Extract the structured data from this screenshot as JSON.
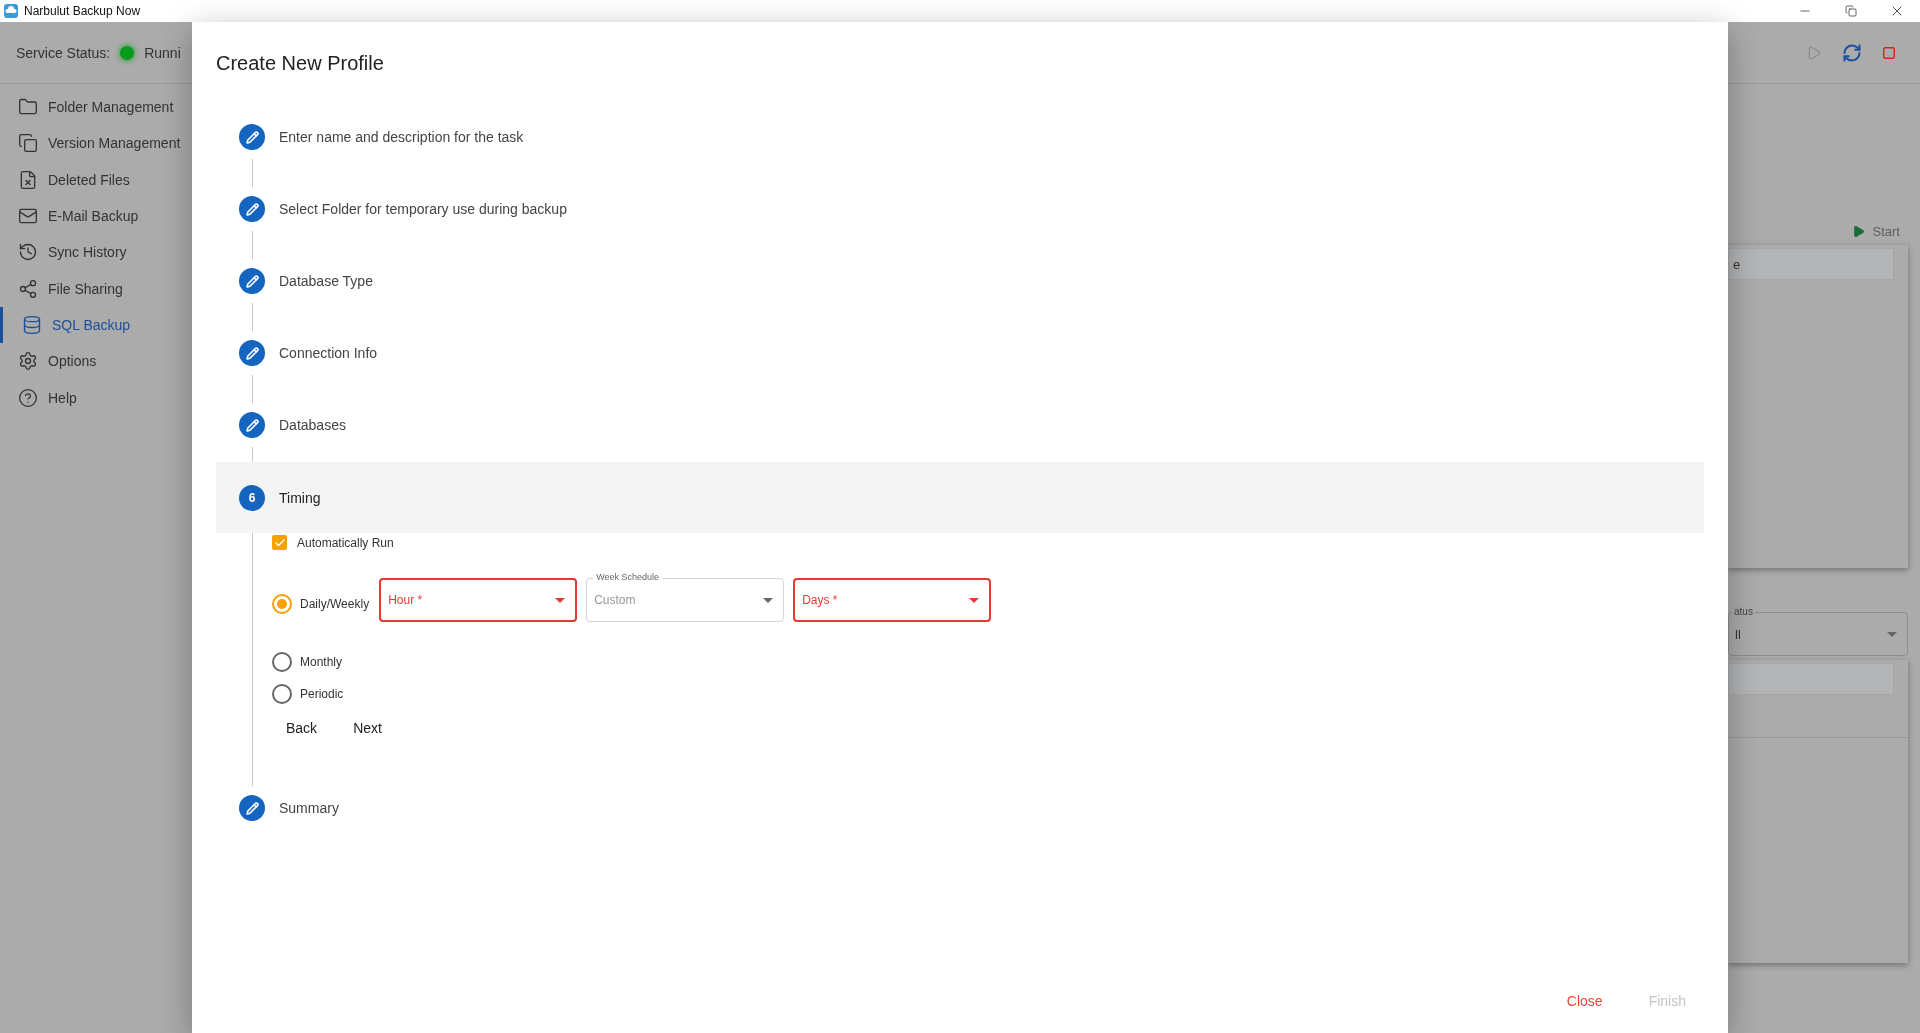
{
  "window": {
    "title": "Narbulut Backup Now"
  },
  "status": {
    "label": "Service Status:",
    "value": "Runni",
    "color": "#0a9a1e"
  },
  "sidebar": {
    "items": [
      {
        "label": "Folder Management",
        "selected": false
      },
      {
        "label": "Version Management",
        "selected": false
      },
      {
        "label": "Deleted Files",
        "selected": false
      },
      {
        "label": "E-Mail Backup",
        "selected": false
      },
      {
        "label": "Sync History",
        "selected": false
      },
      {
        "label": "File Sharing",
        "selected": false
      },
      {
        "label": "SQL Backup",
        "selected": true
      },
      {
        "label": "Options",
        "selected": false
      },
      {
        "label": "Help",
        "selected": false
      }
    ]
  },
  "background": {
    "start_button": "Start",
    "table_header": "e",
    "status_select": {
      "label": "atus",
      "value": "ll"
    }
  },
  "dialog": {
    "title": "Create New Profile",
    "steps": [
      {
        "label": "Enter name and description for the task",
        "selected": false
      },
      {
        "label": "Select Folder for temporary use during backup",
        "selected": false
      },
      {
        "label": "Database Type",
        "selected": false
      },
      {
        "label": "Connection Info",
        "selected": false
      },
      {
        "label": "Databases",
        "selected": false
      },
      {
        "label": "Timing",
        "selected": true,
        "number": "6"
      },
      {
        "label": "Summary",
        "selected": false
      }
    ],
    "timing": {
      "auto_run": {
        "label": "Automatically Run",
        "checked": true
      },
      "modes": [
        {
          "label": "Daily/Weekly",
          "selected": true
        },
        {
          "label": "Monthly",
          "selected": false
        },
        {
          "label": "Periodic",
          "selected": false
        }
      ],
      "fields": [
        {
          "label": "Hour *",
          "error": true
        },
        {
          "label": "Week Schedule",
          "value": "Custom",
          "error": false
        },
        {
          "label": "Days *",
          "error": true
        }
      ],
      "back": "Back",
      "next": "Next"
    },
    "actions": [
      {
        "label": "Close",
        "disabled": false
      },
      {
        "label": "Finish",
        "disabled": true
      }
    ]
  }
}
